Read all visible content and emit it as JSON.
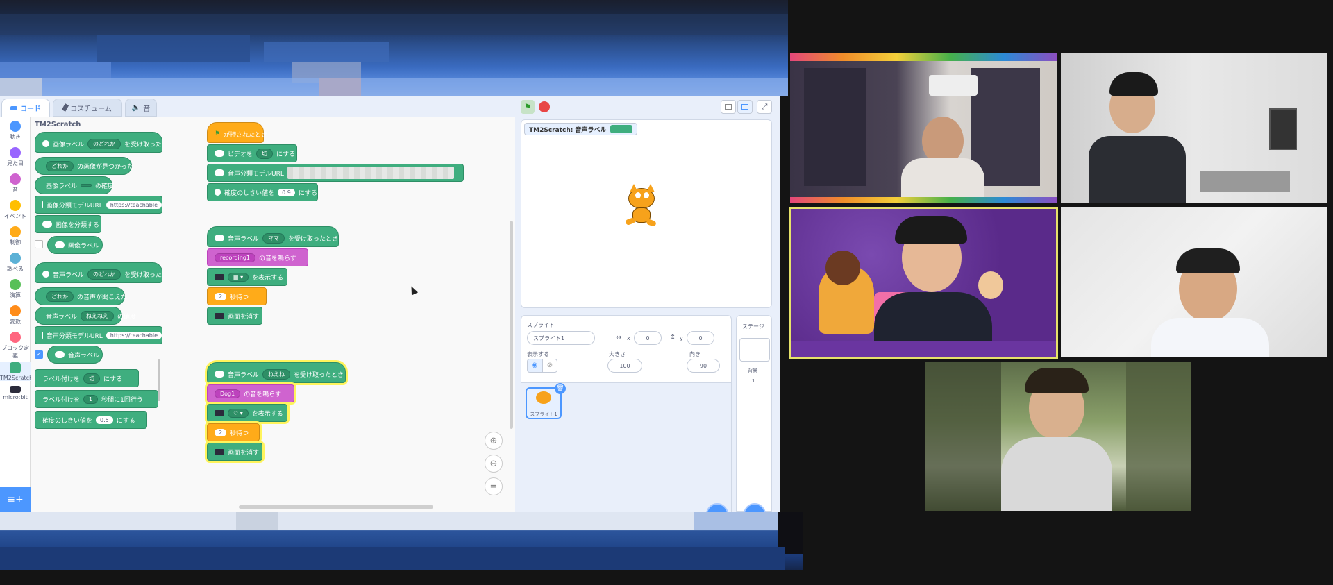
{
  "editor": {
    "tabs": [
      {
        "label": "コード",
        "icon": "code-icon"
      },
      {
        "label": "コスチューム",
        "icon": "brush-icon"
      },
      {
        "label": "音",
        "icon": "speaker-icon"
      }
    ],
    "categories": [
      {
        "label": "動き",
        "color": "#4c97ff"
      },
      {
        "label": "見た目",
        "color": "#9966ff"
      },
      {
        "label": "音",
        "color": "#cf63cf"
      },
      {
        "label": "イベント",
        "color": "#ffbf00"
      },
      {
        "label": "制御",
        "color": "#ffab19"
      },
      {
        "label": "調べる",
        "color": "#5cb1d6"
      },
      {
        "label": "演算",
        "color": "#59c059"
      },
      {
        "label": "変数",
        "color": "#ff8c1a"
      },
      {
        "label": "ブロック定義",
        "color": "#ff6680"
      },
      {
        "label": "TM2Scratch",
        "color": "#3fae7f"
      },
      {
        "label": "micro:bit",
        "color": "#2b2b3b"
      }
    ],
    "palette": {
      "title": "TM2Scratch",
      "blocks": [
        {
          "t1": "画像ラベル",
          "dd": "のどれか",
          "t2": "を受け取った"
        },
        {
          "t1": "",
          "dd": "どれか",
          "t2": "の画像が見つかった"
        },
        {
          "t1": "画像ラベル",
          "dd": "",
          "t2": "の確度"
        },
        {
          "t1": "画像分類モデルURL",
          "pill": "https://teachable"
        },
        {
          "t1": "画像を分類する"
        },
        {
          "t1": "画像ラベル"
        },
        {
          "t1": "音声ラベル",
          "dd": "のどれか",
          "t2": "を受け取った"
        },
        {
          "t1": "",
          "dd": "どれか",
          "t2": "の音声が聞こえた"
        },
        {
          "t1": "音声ラベル",
          "dd": "ねえねえ",
          "t2": "の確度"
        },
        {
          "t1": "音声分類モデルURL",
          "pill": "https://teachable"
        },
        {
          "t1": "音声ラベル"
        },
        {
          "t1": "ラベル付けを",
          "dd": "切",
          "t2": "にする"
        },
        {
          "t1": "ラベル付けを",
          "dd": "1",
          "t2": "秒間に1回行う"
        },
        {
          "t1": "確度のしきい値を",
          "pill": "0.5",
          "t2": "にする"
        }
      ]
    },
    "script1": {
      "hat": "が押されたとき",
      "b1": "ビデオを",
      "b1dd": "切",
      "b1t": "にする",
      "b2": "音声分類モデルURL",
      "b3": "確度のしきい値を",
      "b3v": "0.9",
      "b3t": "にする"
    },
    "script2": {
      "hat": "音声ラベル",
      "hatdd": "ママ",
      "hatt": "を受け取ったとき",
      "snd": "recording1",
      "sndt": "の音を鳴らす",
      "show": "を表示する",
      "wait": "2",
      "waitt": "秒待つ",
      "clear": "画面を消す"
    },
    "script3": {
      "hat": "音声ラベル",
      "hatdd": "ねえね",
      "hatt": "を受け取ったとき",
      "snd": "Dog1",
      "sndt": "の音を鳴らす",
      "show": "を表示する",
      "wait": "2",
      "waitt": "秒待つ",
      "clear": "画面を消す"
    },
    "stage": {
      "monitor_label": "TM2Scratch: 音声ラベル"
    },
    "sprite_info": {
      "heading": "スプライト",
      "name": "スプライト1",
      "x_label": "x",
      "x": "0",
      "y_label": "y",
      "y": "0",
      "show_label": "表示する",
      "size_label": "大きさ",
      "size": "100",
      "direction_label": "向き",
      "direction": "90",
      "thumb_label": "スプライト1"
    },
    "stage_pane": {
      "heading": "ステージ",
      "backdrop_label": "背景",
      "backdrop_count": "1"
    }
  },
  "colors": {
    "block_green": "#3fae7f",
    "block_orange": "#ffab19",
    "block_pink": "#cf63cf",
    "scratch_blue": "#4c97ff",
    "highlight_yellow": "#fff45c"
  }
}
